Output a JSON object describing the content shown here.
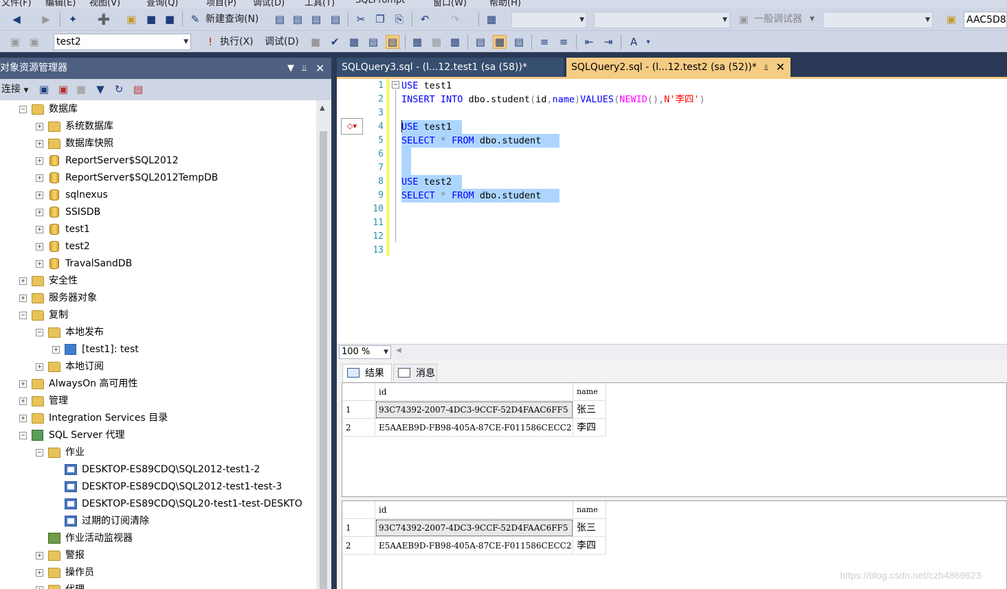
{
  "menu": [
    "文件(F)",
    "编辑(E)",
    "视图(V)",
    "查询(Q)",
    "项目(P)",
    "调试(D)",
    "工具(T)",
    "SQLPrompt",
    "窗口(W)",
    "帮助(H)"
  ],
  "toolbar1": {
    "new_query_label": "新建查询(N)",
    "debugger_label": "一般调试器",
    "server_box": "AAC5D8"
  },
  "toolbar2": {
    "database": "test2",
    "execute_label": "执行(X)",
    "debug_label": "调试(D)"
  },
  "object_explorer": {
    "title": "对象资源管理器",
    "connect_label": "连接",
    "tree": [
      {
        "label": "数据库",
        "level": 1,
        "state": "expanded",
        "icon": "folder-icon"
      },
      {
        "label": "系统数据库",
        "level": 2,
        "state": "collapsed",
        "icon": "folder-icon"
      },
      {
        "label": "数据库快照",
        "level": 2,
        "state": "collapsed",
        "icon": "folder-icon"
      },
      {
        "label": "ReportServer$SQL2012",
        "level": 2,
        "state": "collapsed",
        "icon": "database-icon"
      },
      {
        "label": "ReportServer$SQL2012TempDB",
        "level": 2,
        "state": "collapsed",
        "icon": "database-icon"
      },
      {
        "label": "sqlnexus",
        "level": 2,
        "state": "collapsed",
        "icon": "database-icon"
      },
      {
        "label": "SSISDB",
        "level": 2,
        "state": "collapsed",
        "icon": "database-icon"
      },
      {
        "label": "test1",
        "level": 2,
        "state": "collapsed",
        "icon": "database-icon"
      },
      {
        "label": "test2",
        "level": 2,
        "state": "collapsed",
        "icon": "database-icon"
      },
      {
        "label": "TravalSandDB",
        "level": 2,
        "state": "collapsed",
        "icon": "database-icon"
      },
      {
        "label": "安全性",
        "level": 1,
        "state": "collapsed",
        "icon": "folder-icon"
      },
      {
        "label": "服务器对象",
        "level": 1,
        "state": "collapsed",
        "icon": "folder-icon"
      },
      {
        "label": "复制",
        "level": 1,
        "state": "expanded",
        "icon": "folder-icon"
      },
      {
        "label": "本地发布",
        "level": 2,
        "state": "expanded",
        "icon": "folder-icon"
      },
      {
        "label": "[test1]: test",
        "level": 3,
        "state": "collapsed",
        "icon": "publication-icon"
      },
      {
        "label": "本地订阅",
        "level": 2,
        "state": "collapsed",
        "icon": "folder-icon"
      },
      {
        "label": "AlwaysOn 高可用性",
        "level": 1,
        "state": "collapsed",
        "icon": "folder-icon"
      },
      {
        "label": "管理",
        "level": 1,
        "state": "collapsed",
        "icon": "folder-icon"
      },
      {
        "label": "Integration Services 目录",
        "level": 1,
        "state": "collapsed",
        "icon": "folder-icon"
      },
      {
        "label": "SQL Server 代理",
        "level": 1,
        "state": "expanded",
        "icon": "agent-icon"
      },
      {
        "label": "作业",
        "level": 2,
        "state": "expanded",
        "icon": "folder-icon"
      },
      {
        "label": "DESKTOP-ES89CDQ\\SQL2012-test1-2",
        "level": 3,
        "state": "none",
        "icon": "job-icon"
      },
      {
        "label": "DESKTOP-ES89CDQ\\SQL2012-test1-test-3",
        "level": 3,
        "state": "none",
        "icon": "job-icon"
      },
      {
        "label": "DESKTOP-ES89CDQ\\SQL20-test1-test-DESKTO",
        "level": 3,
        "state": "none",
        "icon": "job-icon"
      },
      {
        "label": "过期的订阅清除",
        "level": 3,
        "state": "none",
        "icon": "job-icon"
      },
      {
        "label": "作业活动监视器",
        "level": 2,
        "state": "none",
        "icon": "monitor-icon"
      },
      {
        "label": "警报",
        "level": 2,
        "state": "collapsed",
        "icon": "folder-icon"
      },
      {
        "label": "操作员",
        "level": 2,
        "state": "collapsed",
        "icon": "folder-icon"
      },
      {
        "label": "代理",
        "level": 2,
        "state": "collapsed",
        "icon": "folder-icon"
      }
    ]
  },
  "tabs": [
    {
      "label": "SQLQuery3.sql - (l...12.test1 (sa (58))*",
      "active": false
    },
    {
      "label": "SQLQuery2.sql - (l...12.test2 (sa (52))*",
      "active": true
    }
  ],
  "editor": {
    "line_numbers": [
      "1",
      "2",
      "3",
      "4",
      "5",
      "6",
      "7",
      "8",
      "9",
      "10",
      "11",
      "12",
      "13"
    ],
    "lines": [
      [
        {
          "t": "USE",
          "c": "kw"
        },
        {
          "t": " test1",
          "c": ""
        }
      ],
      [
        {
          "t": "INSERT INTO",
          "c": "kw"
        },
        {
          "t": " dbo.student",
          "c": ""
        },
        {
          "t": "(",
          "c": "gray"
        },
        {
          "t": "id",
          "c": ""
        },
        {
          "t": ",",
          "c": "gray"
        },
        {
          "t": "name",
          "c": "kw"
        },
        {
          "t": ")",
          "c": "gray"
        },
        {
          "t": "VALUES",
          "c": "kw"
        },
        {
          "t": "(",
          "c": "gray"
        },
        {
          "t": "NEWID",
          "c": "fn"
        },
        {
          "t": "(),",
          "c": "gray"
        },
        {
          "t": "N'李四'",
          "c": "str"
        },
        {
          "t": ")",
          "c": "gray"
        }
      ],
      [],
      [
        {
          "t": "USE",
          "c": "kw"
        },
        {
          "t": " test1",
          "c": ""
        }
      ],
      [
        {
          "t": "SELECT",
          "c": "kw"
        },
        {
          "t": " * ",
          "c": "gray"
        },
        {
          "t": "FROM",
          "c": "kw"
        },
        {
          "t": " dbo.student",
          "c": ""
        }
      ],
      [
        {
          "t": "  ",
          "c": ""
        }
      ],
      [],
      [
        {
          "t": "USE",
          "c": "kw"
        },
        {
          "t": " test2",
          "c": ""
        }
      ],
      [
        {
          "t": "SELECT",
          "c": "kw"
        },
        {
          "t": " * ",
          "c": "gray"
        },
        {
          "t": "FROM",
          "c": "kw"
        },
        {
          "t": " dbo.student",
          "c": ""
        }
      ],
      [],
      [],
      [],
      []
    ],
    "colors": {
      "keyword": "#0000ff",
      "function": "#ff00ff",
      "string": "#ff0000",
      "selection": "#add6ff"
    }
  },
  "zoom": "100 %",
  "results": {
    "tab_results": "结果",
    "tab_messages": "消息",
    "grids": [
      {
        "columns": [
          "id",
          "name"
        ],
        "rows": [
          [
            "1",
            "93C74392-2007-4DC3-9CCF-52D4FAAC6FF5",
            "张三"
          ],
          [
            "2",
            "E5AAEB9D-FB98-405A-87CE-F011586CECC2",
            "李四"
          ]
        ]
      },
      {
        "columns": [
          "id",
          "name"
        ],
        "rows": [
          [
            "1",
            "93C74392-2007-4DC3-9CCF-52D4FAAC6FF5",
            "张三"
          ],
          [
            "2",
            "E5AAEB9D-FB98-405A-87CE-F011586CECC2",
            "李四"
          ]
        ]
      }
    ]
  },
  "watermark": "https://blog.csdn.net/czh4869623"
}
